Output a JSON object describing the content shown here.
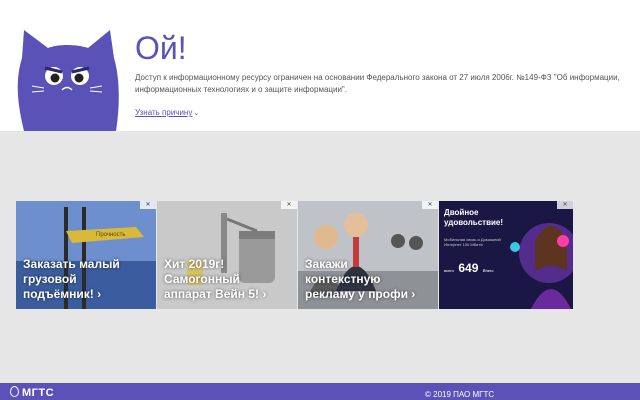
{
  "message": {
    "title": "Ой!",
    "description": "Доступ к информационному ресурсу ограничен на основании Федерального закона от 27 июля 2006г. №149-ФЗ \"Об информации, информационных технологиях и о защите информации\".",
    "reason_link": "Узнать причину"
  },
  "ads": [
    {
      "caption": "Заказать малый грузовой подъёмник! ›",
      "image_text": "Прочность"
    },
    {
      "caption": "Хит 2019г! Самогонный аппарат Вейн 5! ›"
    },
    {
      "caption": "Закажи контекстную рекламу у профи ›"
    },
    {
      "headline": "Двойное удовольствие!",
      "subtext": "Мобильная связь и Домашний Интернет 100 Мбит/с",
      "price_prefix": "всего",
      "price": "649",
      "price_unit": "₽/мес"
    }
  ],
  "footer": {
    "brand": "МГТС",
    "copyright": "© 2019 ПАО МГТС"
  },
  "colors": {
    "accent": "#5a52b7",
    "background_grey": "#e6e6e6"
  },
  "icons": {
    "mascot": "cat-icon",
    "ad_close": "close-icon",
    "reason_chevron": "chevron-down-icon",
    "brand_logo": "mgts-logo-icon"
  }
}
